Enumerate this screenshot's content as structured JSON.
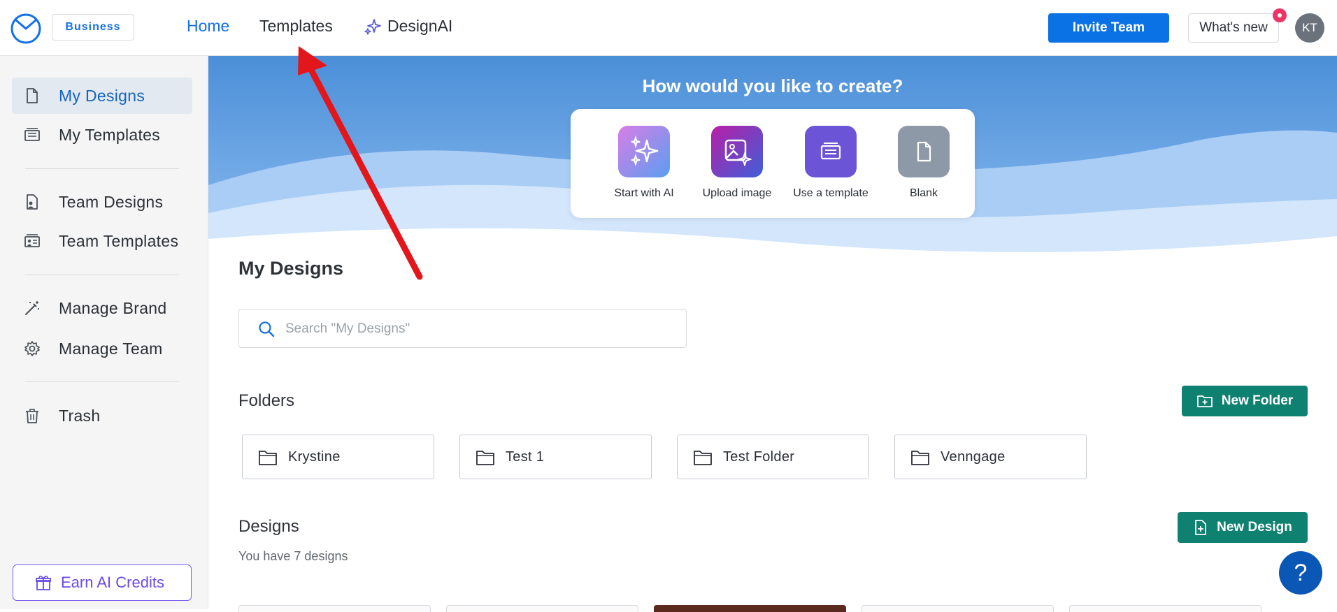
{
  "topbar": {
    "plan_badge": "Business",
    "nav": {
      "home": "Home",
      "templates": "Templates",
      "designai": "DesignAI"
    },
    "invite_button": "Invite Team",
    "whats_new_button": "What's new",
    "avatar_initials": "KT"
  },
  "sidebar": {
    "items": [
      {
        "label": "My Designs",
        "icon": "document-icon",
        "active": true
      },
      {
        "label": "My Templates",
        "icon": "template-icon"
      },
      {
        "label": "Team Designs",
        "icon": "team-document-icon"
      },
      {
        "label": "Team Templates",
        "icon": "team-template-icon"
      },
      {
        "label": "Manage Brand",
        "icon": "magic-wand-icon"
      },
      {
        "label": "Manage Team",
        "icon": "gear-icon"
      },
      {
        "label": "Trash",
        "icon": "trash-icon"
      }
    ],
    "earn_credits": "Earn AI Credits"
  },
  "hero": {
    "title": "How would you like to create?",
    "options": [
      {
        "label": "Start with AI",
        "icon": "sparkle-icon",
        "color": "#b57ee8"
      },
      {
        "label": "Upload image",
        "icon": "image-icon",
        "color": "#8a2bb5"
      },
      {
        "label": "Use a template",
        "icon": "template-icon",
        "color": "#6b54d6"
      },
      {
        "label": "Blank",
        "icon": "blank-document-icon",
        "color": "#8e99a8"
      }
    ]
  },
  "main": {
    "title": "My Designs",
    "search_placeholder": "Search \"My Designs\"",
    "folders_title": "Folders",
    "new_folder_button": "New Folder",
    "folders": [
      "Krystine",
      "Test 1",
      "Test Folder",
      "Venngage"
    ],
    "designs_title": "Designs",
    "designs_count": "You have 7 designs",
    "new_design_button": "New Design"
  },
  "help_button": "?",
  "colors": {
    "primary_blue": "#0b72e6",
    "teal": "#0f8170",
    "accent_purple": "#6a4be8",
    "annotation_red": "#e3161b"
  }
}
